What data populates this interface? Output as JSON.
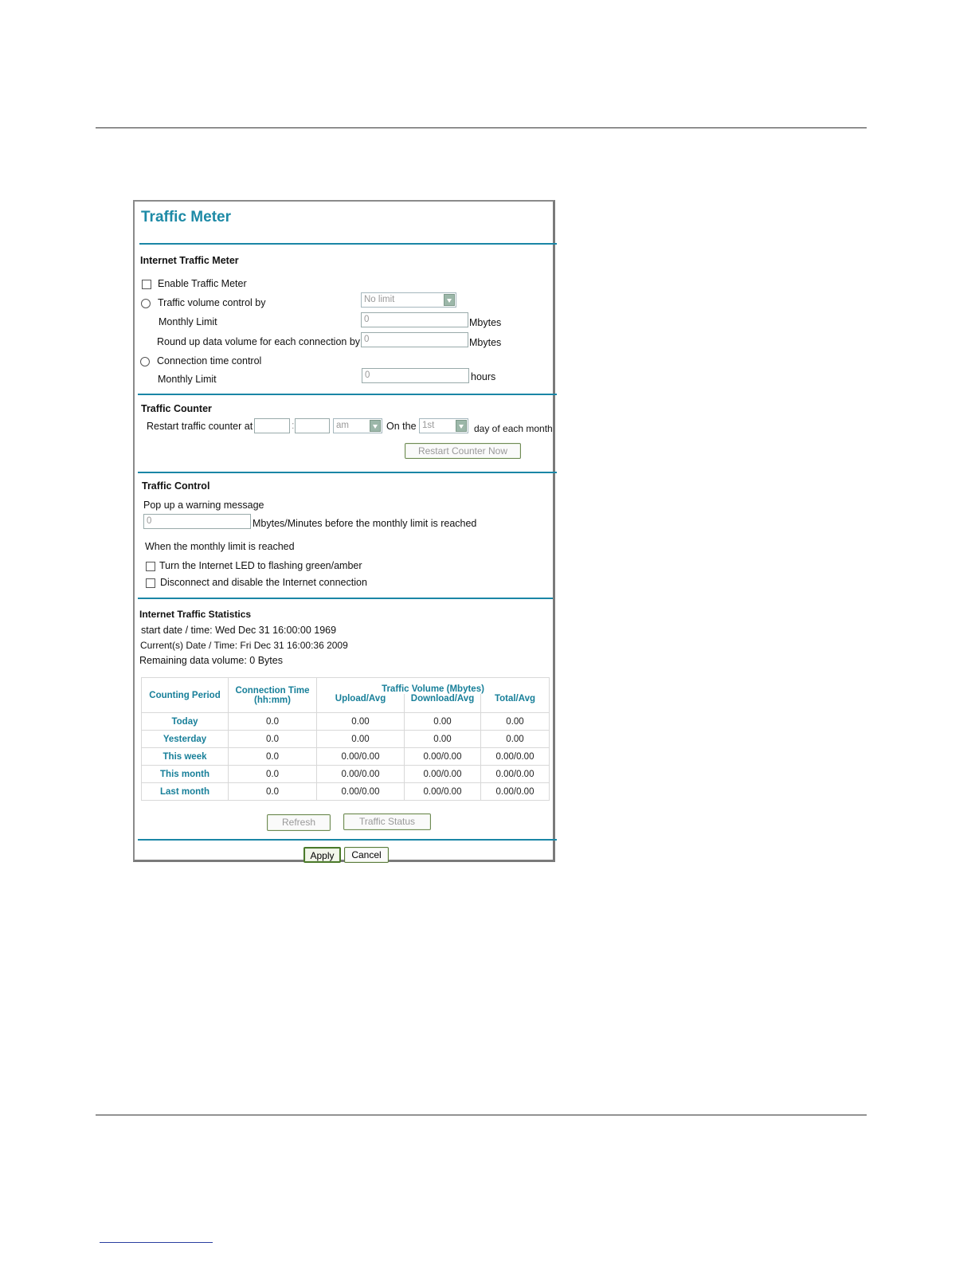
{
  "page": {
    "title": "Traffic Meter"
  },
  "meter": {
    "section_title": "Internet Traffic Meter",
    "enable_label": "Enable Traffic Meter",
    "volume_control_label": "Traffic volume control by",
    "volume_control_value": "No limit",
    "monthly_limit_label": "Monthly Limit",
    "monthly_limit_value": "0",
    "monthly_limit_unit": "Mbytes",
    "round_up_label": "Round up data volume for each connection by",
    "round_up_value": "0",
    "round_up_unit": "Mbytes",
    "time_control_label": "Connection time control",
    "time_limit_label": "Monthly Limit",
    "time_limit_value": "0",
    "time_limit_unit": "hours"
  },
  "counter": {
    "section_title": "Traffic Counter",
    "restart_label": "Restart traffic counter at",
    "hour_value": "",
    "minute_value": "",
    "time_sep": ":",
    "ampm_value": "am",
    "on_the_label": "On the",
    "day_value": "1st",
    "day_suffix": "day of each month",
    "restart_now_button": "Restart Counter Now"
  },
  "control": {
    "section_title": "Traffic Control",
    "popup_label": "Pop up a warning message",
    "warning_value": "0",
    "warning_suffix": "Mbytes/Minutes before the monthly limit is reached",
    "when_reached_label": "When the monthly limit is reached",
    "led_label": "Turn the Internet LED to flashing green/amber",
    "disconnect_label": "Disconnect and disable the Internet connection"
  },
  "statistics": {
    "section_title": "Internet Traffic Statistics",
    "start_line": "start date / time: Wed Dec 31 16:00:00 1969",
    "current_line": "Current(s) Date / Time: Fri Dec 31 16:00:36 2009",
    "remaining_line": "Remaining data volume: 0 Bytes",
    "headers": {
      "period": "Counting Period",
      "connection_time": "Connection Time",
      "connection_time_unit": "(hh:mm)",
      "volume": "Traffic Volume (Mbytes)",
      "upload": "Upload/Avg",
      "download": "Download/Avg",
      "total": "Total/Avg"
    },
    "rows": [
      {
        "period": "Today",
        "time": "0.0",
        "upload": "0.00",
        "download": "0.00",
        "total": "0.00"
      },
      {
        "period": "Yesterday",
        "time": "0.0",
        "upload": "0.00",
        "download": "0.00",
        "total": "0.00"
      },
      {
        "period": "This week",
        "time": "0.0",
        "upload": "0.00/0.00",
        "download": "0.00/0.00",
        "total": "0.00/0.00"
      },
      {
        "period": "This month",
        "time": "0.0",
        "upload": "0.00/0.00",
        "download": "0.00/0.00",
        "total": "0.00/0.00"
      },
      {
        "period": "Last month",
        "time": "0.0",
        "upload": "0.00/0.00",
        "download": "0.00/0.00",
        "total": "0.00/0.00"
      }
    ],
    "refresh_button": "Refresh",
    "status_button": "Traffic Status"
  },
  "footer": {
    "apply_button": "Apply",
    "cancel_button": "Cancel"
  },
  "colors": {
    "accent": "#1d8aa6",
    "button_border": "#6f8a55"
  }
}
